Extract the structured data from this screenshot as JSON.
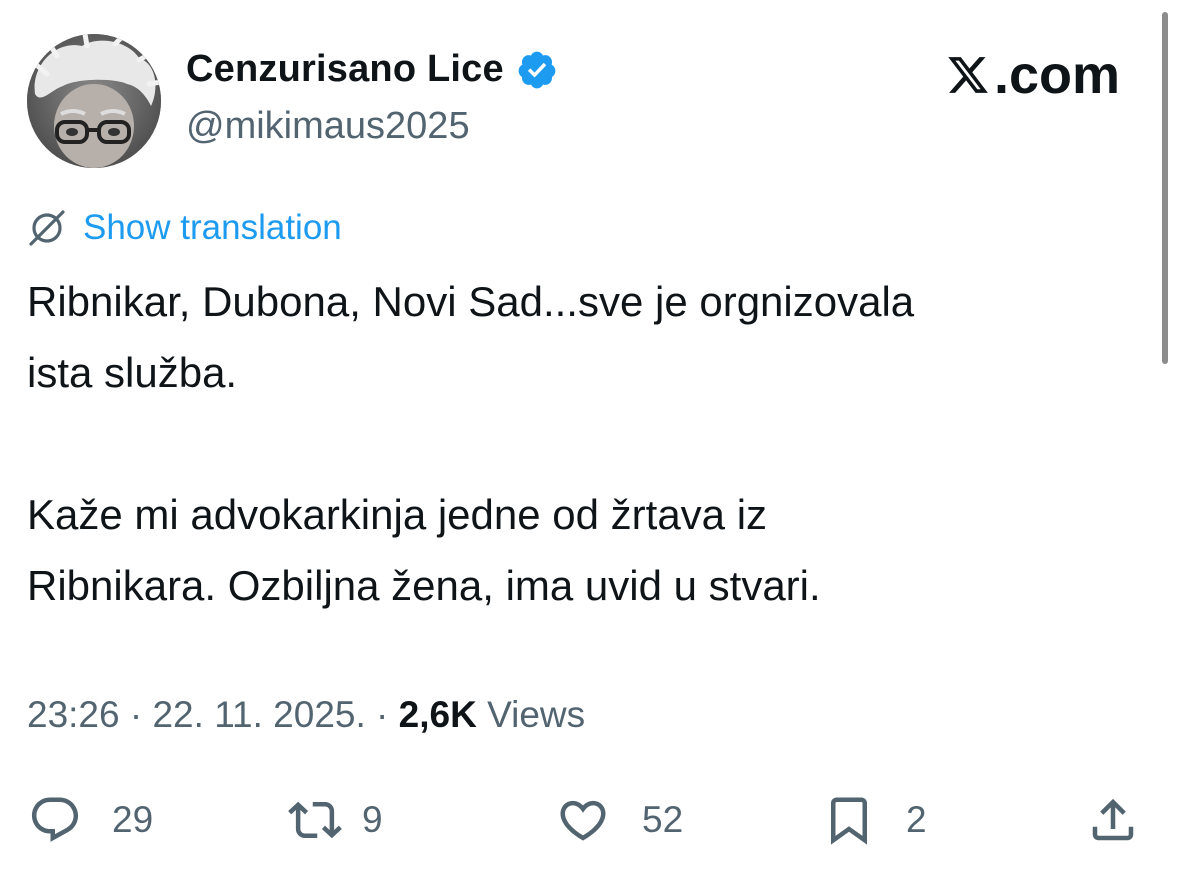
{
  "profile": {
    "display_name": "Cenzurisano Lice",
    "handle": "@mikimaus2025",
    "verified": true
  },
  "brand": {
    "site": ".com"
  },
  "translate": {
    "label": "Show translation"
  },
  "tweet": {
    "paragraph_1_line_1": "Ribnikar, Dubona, Novi Sad...sve je orgnizovala",
    "paragraph_1_line_2": "ista služba.",
    "paragraph_2_line_1": "Kaže mi advokarkinja jedne od žrtava iz",
    "paragraph_2_line_2": "Ribnikara.  Ozbiljna žena, ima uvid u stvari."
  },
  "meta": {
    "time": "23:26",
    "separator": "·",
    "date": "22. 11. 2025.",
    "views_count": "2,6K",
    "views_label": "Views"
  },
  "actions": {
    "replies": "29",
    "reposts": "9",
    "likes": "52",
    "bookmarks": "2"
  },
  "colors": {
    "accent": "#1d9bf0",
    "text": "#0f1419",
    "secondary": "#536471",
    "verified_badge": "#1d9bf0"
  },
  "icons": {
    "translate": "globe-slash-icon",
    "reply": "speech-bubble-icon",
    "repost": "repost-arrows-icon",
    "like": "heart-icon",
    "bookmark": "bookmark-icon",
    "share": "share-upload-icon",
    "verified": "verified-badge-icon",
    "brand": "x-logo-icon"
  }
}
